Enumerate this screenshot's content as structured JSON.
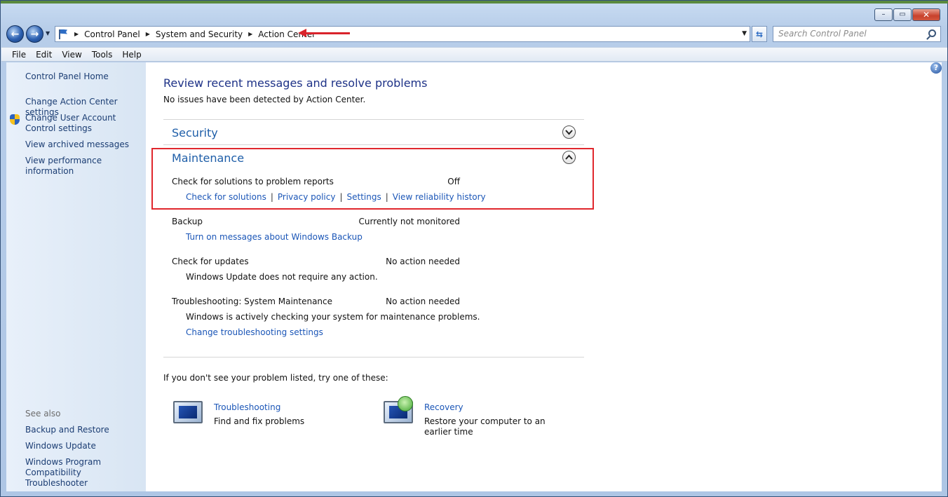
{
  "window": {
    "minimize_glyph": "–",
    "maximize_glyph": "▭",
    "close_glyph": "✕"
  },
  "nav": {
    "back_glyph": "←",
    "forward_glyph": "→",
    "breadcrumbs": [
      "Control Panel",
      "System and Security",
      "Action Center"
    ],
    "search_placeholder": "Search Control Panel"
  },
  "menu": [
    "File",
    "Edit",
    "View",
    "Tools",
    "Help"
  ],
  "sidebar": {
    "home": "Control Panel Home",
    "links": [
      "Change Action Center settings",
      "Change User Account Control settings",
      "View archived messages",
      "View performance information"
    ],
    "see_also_label": "See also",
    "see_also": [
      "Backup and Restore",
      "Windows Update",
      "Windows Program Compatibility Troubleshooter"
    ]
  },
  "main": {
    "help_glyph": "?",
    "title": "Review recent messages and resolve problems",
    "subtitle": "No issues have been detected by Action Center.",
    "security": {
      "title": "Security"
    },
    "maintenance": {
      "title": "Maintenance",
      "items": [
        {
          "label": "Check for solutions to problem reports",
          "status": "Off",
          "links": [
            "Check for solutions",
            "Privacy policy",
            "Settings",
            "View reliability history"
          ]
        },
        {
          "label": "Backup",
          "status": "Currently not monitored",
          "link": "Turn on messages about Windows Backup"
        },
        {
          "label": "Check for updates",
          "status": "No action needed",
          "text": "Windows Update does not require any action."
        },
        {
          "label": "Troubleshooting: System Maintenance",
          "status": "No action needed",
          "text": "Windows is actively checking your system for maintenance problems.",
          "link": "Change troubleshooting settings"
        }
      ]
    },
    "footer": "If you don't see your problem listed, try one of these:",
    "tools": [
      {
        "title": "Troubleshooting",
        "desc": "Find and fix problems"
      },
      {
        "title": "Recovery",
        "desc": "Restore your computer to an earlier time"
      }
    ]
  },
  "colors": {
    "link": "#1b56b7",
    "section_head": "#1e5ea8",
    "title": "#1e3287",
    "highlight": "#e0272d"
  }
}
